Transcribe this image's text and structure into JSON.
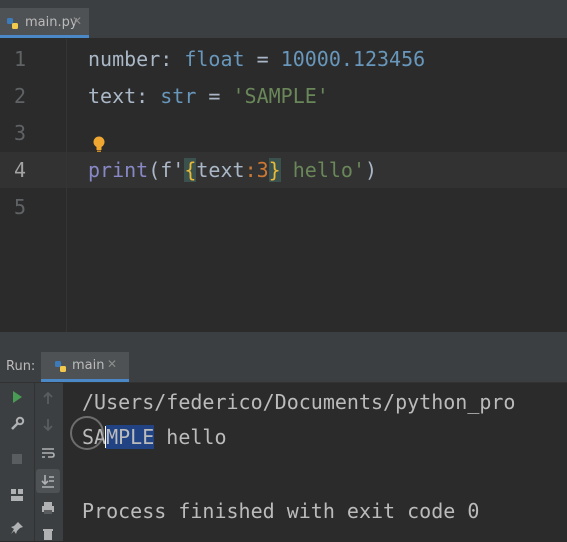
{
  "editor_tab": {
    "filename": "main.py",
    "close": "✕"
  },
  "editor": {
    "line_numbers": [
      "1",
      "2",
      "3",
      "4",
      "5"
    ],
    "line1": {
      "name": "number",
      "colon": ": ",
      "type": "float",
      "eq": " = ",
      "value": "10000.123456"
    },
    "line2": {
      "name": "text",
      "colon": ": ",
      "type": "str",
      "eq": " = ",
      "value": "'SAMPLE'"
    },
    "line4": {
      "fn": "print",
      "open": "(f'",
      "lbrace": "{",
      "expr": "text",
      "spec": ":3",
      "rbrace": "}",
      "rest": " hello'",
      "close": ")"
    }
  },
  "run_panel": {
    "label": "Run:",
    "tab_label": "main",
    "close": "✕",
    "output": {
      "path": "/Users/federico/Documents/python_pro",
      "sample_pre": "SA",
      "sample_sel": "MPLE",
      "sample_post": " hello",
      "finished": "Process finished with exit code 0"
    }
  },
  "icons": [
    "python-file-icon",
    "lightbulb-icon",
    "run-icon",
    "wrench-icon",
    "stop-icon",
    "layout-icon",
    "pin-icon",
    "arrow-up-icon",
    "arrow-down-icon",
    "soft-wrap-icon",
    "scroll-to-end-icon",
    "print-icon",
    "trash-icon"
  ],
  "colors": {
    "accent": "#4a88c7",
    "keyword": "#6897bb",
    "string": "#6a8759",
    "builtin": "#8888c6",
    "selection": "#214283"
  }
}
